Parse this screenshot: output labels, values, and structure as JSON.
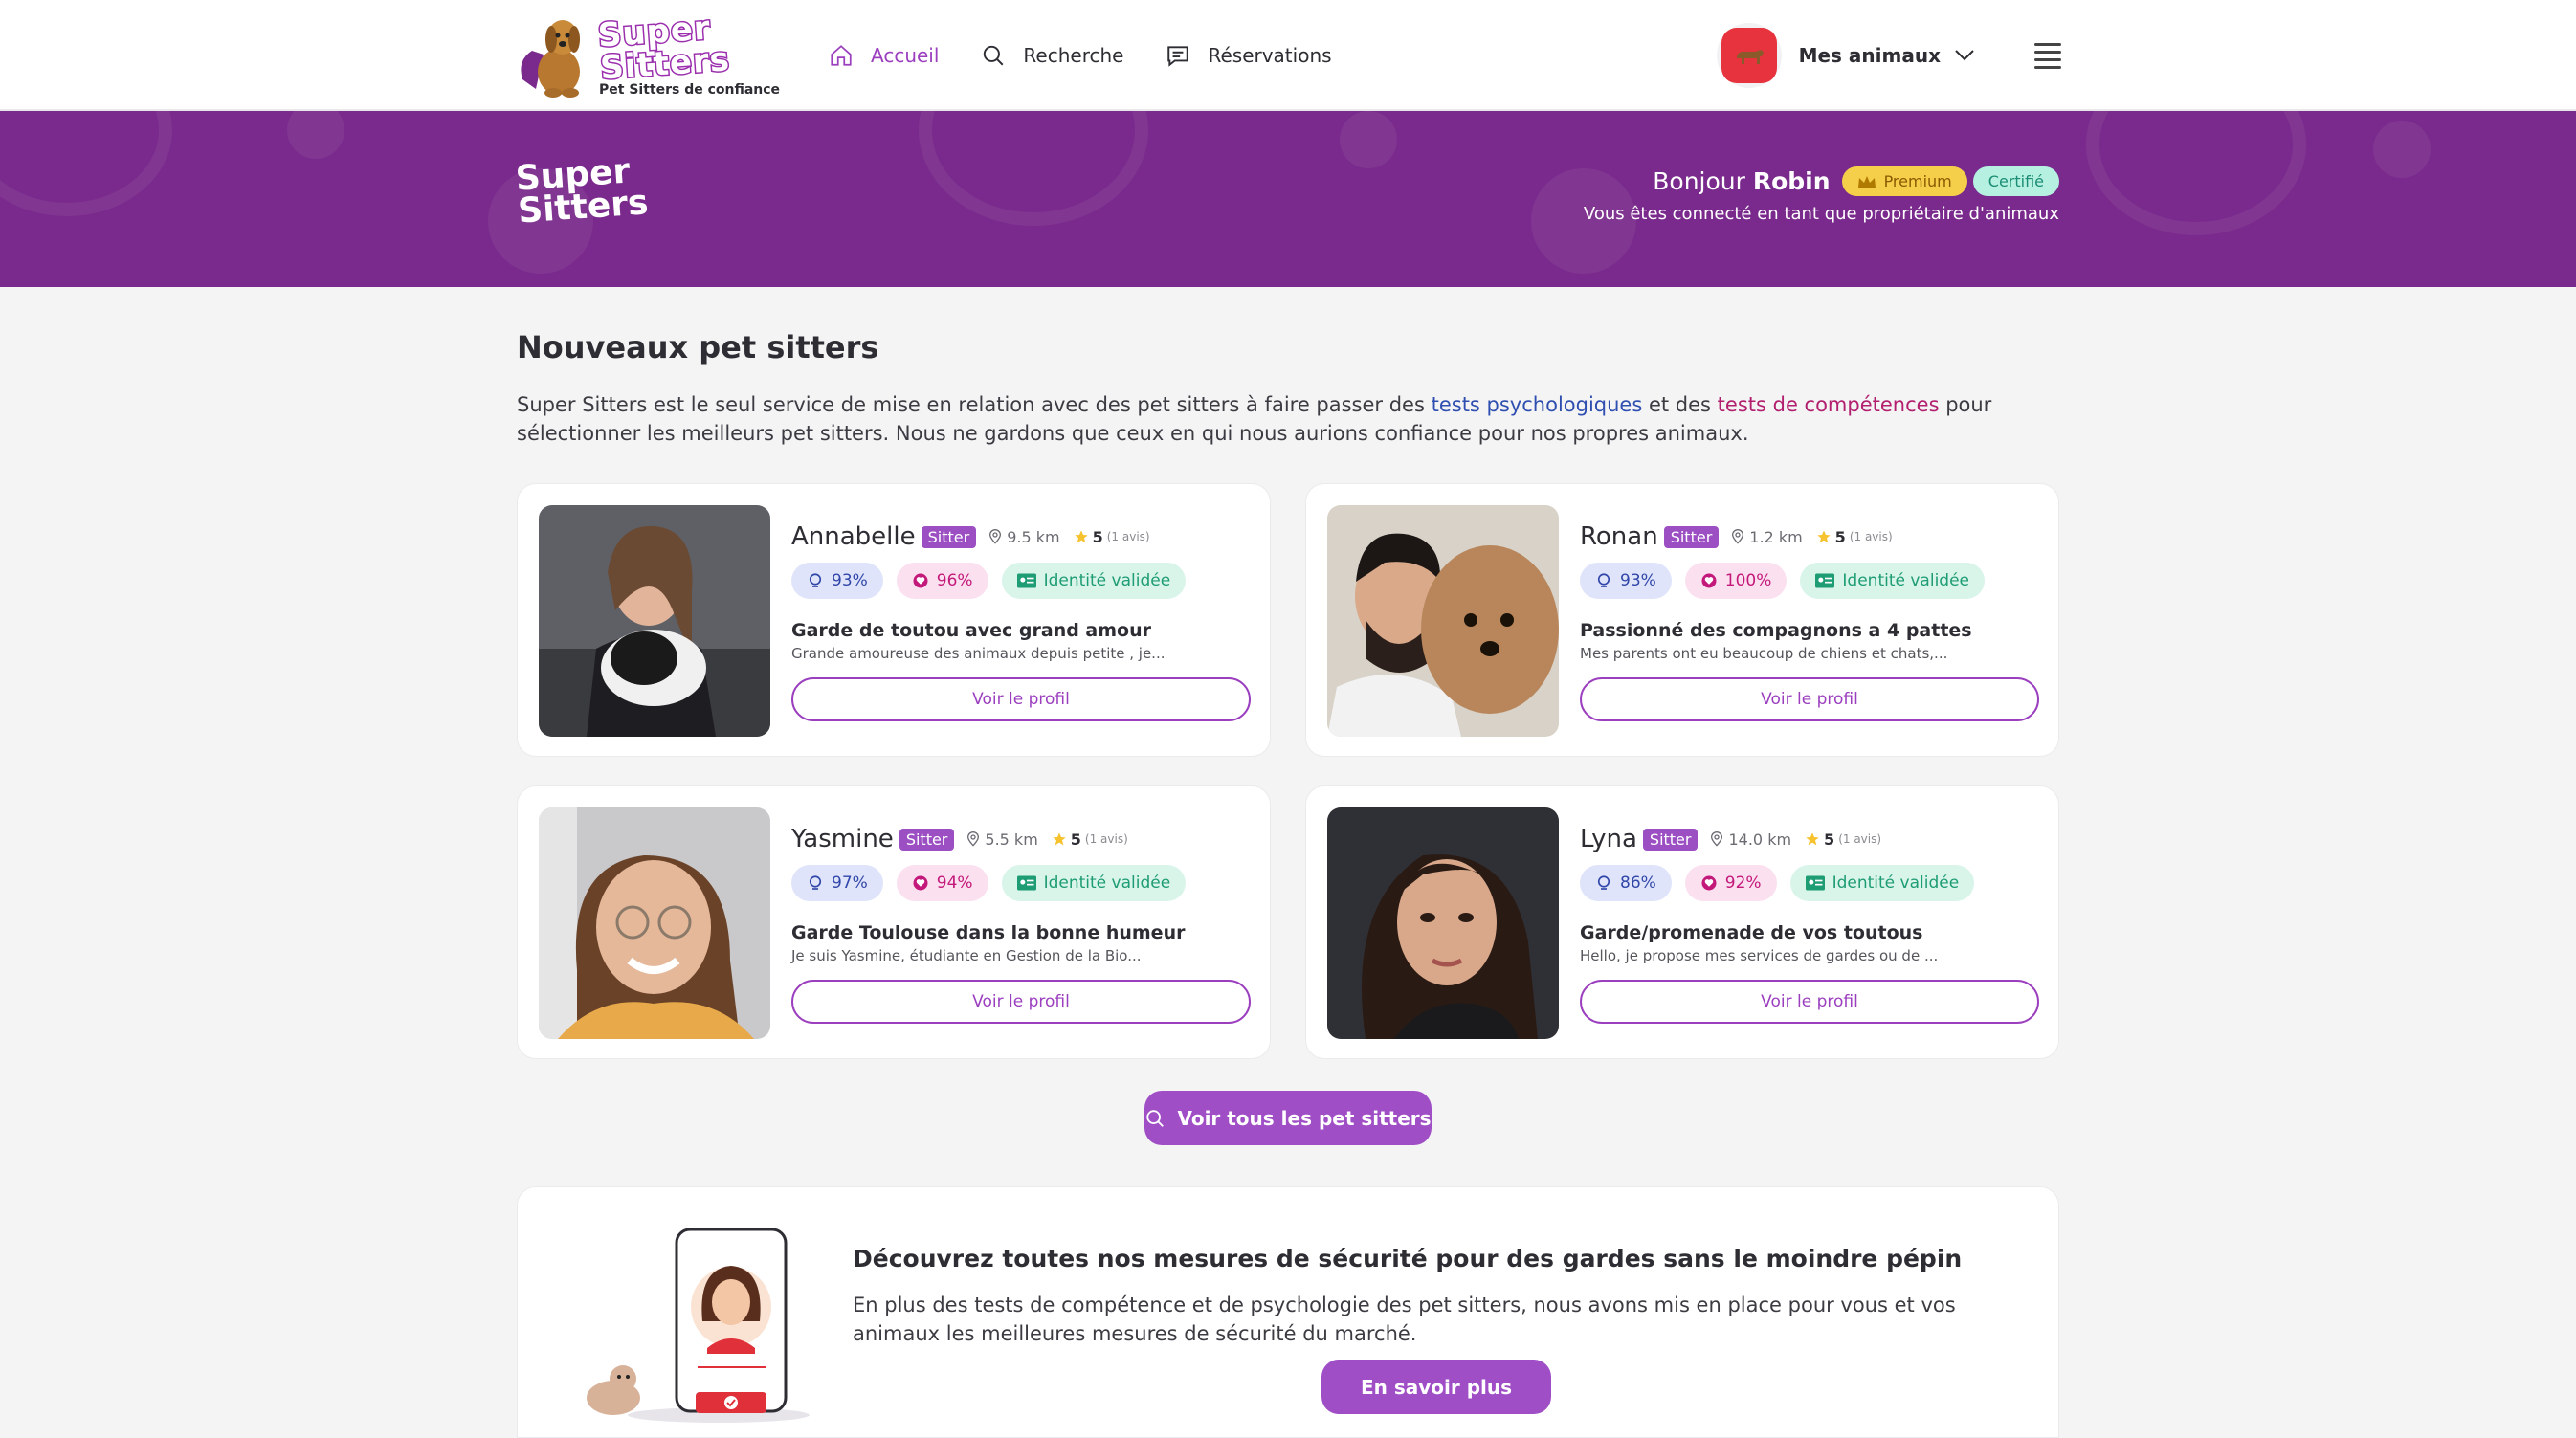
{
  "nav": {
    "logo_line1": "Super",
    "logo_line2": "Sitters",
    "logo_tagline": "Pet Sitters de confiance",
    "links": [
      {
        "label": "Accueil",
        "icon": "home-icon",
        "active": true
      },
      {
        "label": "Recherche",
        "icon": "search-icon",
        "active": false
      },
      {
        "label": "Réservations",
        "icon": "chat-icon",
        "active": false
      }
    ],
    "pets_label": "Mes animaux"
  },
  "banner": {
    "logo_line1": "Super",
    "logo_line2": "Sitters",
    "greeting": "Bonjour",
    "user_name": "Robin",
    "premium_label": "Premium",
    "certified_label": "Certifié",
    "subtitle": "Vous êtes connecté en tant que propriétaire d'animaux"
  },
  "section": {
    "title": "Nouveaux pet sitters",
    "intro_1": "Super Sitters est le seul service de mise en relation avec des pet sitters à faire passer des ",
    "intro_link1": "tests psychologiques",
    "intro_2": " et des ",
    "intro_link2": "tests de compétences",
    "intro_3": " pour sélectionner les meilleurs pet sitters. Nous ne gardons que ceux en qui nous aurions confiance pour nos propres animaux."
  },
  "sitters": [
    {
      "name": "Annabelle",
      "tag": "Sitter",
      "distance": "9.5 km",
      "rating": "5",
      "reviews": "(1 avis)",
      "psy": "93%",
      "skill": "96%",
      "identity": "Identité validée",
      "title": "Garde de toutou avec grand amour",
      "desc": "Grande amoureuse des animaux depuis petite , je...",
      "button": "Voir le profil"
    },
    {
      "name": "Ronan",
      "tag": "Sitter",
      "distance": "1.2 km",
      "rating": "5",
      "reviews": "(1 avis)",
      "psy": "93%",
      "skill": "100%",
      "identity": "Identité validée",
      "title": "Passionné des compagnons a 4 pattes",
      "desc": "Mes parents ont eu beaucoup de chiens et chats,...",
      "button": "Voir le profil"
    },
    {
      "name": "Yasmine",
      "tag": "Sitter",
      "distance": "5.5 km",
      "rating": "5",
      "reviews": "(1 avis)",
      "psy": "97%",
      "skill": "94%",
      "identity": "Identité validée",
      "title": "Garde Toulouse dans la bonne humeur",
      "desc": "Je suis Yasmine, étudiante en Gestion de la Bio...",
      "button": "Voir le profil"
    },
    {
      "name": "Lyna",
      "tag": "Sitter",
      "distance": "14.0 km",
      "rating": "5",
      "reviews": "(1 avis)",
      "psy": "86%",
      "skill": "92%",
      "identity": "Identité validée",
      "title": "Garde/promenade de vos toutous",
      "desc": "Hello, je propose mes services de gardes ou de ...",
      "button": "Voir le profil"
    }
  ],
  "see_all_label": "Voir tous les pet sitters",
  "security": {
    "title": "Découvrez toutes nos mesures de sécurité pour des gardes sans le moindre pépin",
    "text": "En plus des tests de compétence et de psychologie des pet sitters, nous avons mis en place pour vous et vos animaux les meilleures mesures de sécurité du marché.",
    "button": "En savoir plus"
  },
  "colors": {
    "accent": "#9b3fbf",
    "banner": "#7a2a8c",
    "premium": "#f6cf4a",
    "certified": "#b6f0e1"
  }
}
